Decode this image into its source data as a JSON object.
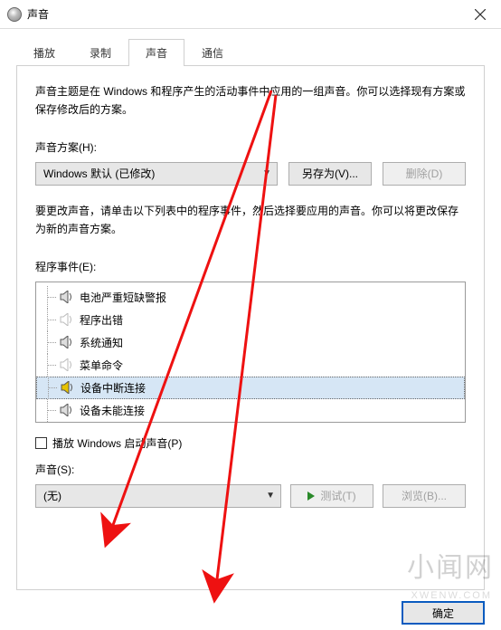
{
  "window": {
    "title": "声音"
  },
  "tabs": [
    "播放",
    "录制",
    "声音",
    "通信"
  ],
  "panel": {
    "description": "声音主题是在 Windows 和程序产生的活动事件中应用的一组声音。你可以选择现有方案或保存修改后的方案。",
    "scheme_label": "声音方案(H):",
    "scheme_value": "Windows 默认 (已修改)",
    "save_as": "另存为(V)...",
    "delete": "删除(D)",
    "events_description": "要更改声音，请单击以下列表中的程序事件，然后选择要应用的声音。你可以将更改保存为新的声音方案。",
    "events_label": "程序事件(E):",
    "events": [
      {
        "label": "电池严重短缺警报",
        "has_sound": true,
        "selected": false
      },
      {
        "label": "程序出错",
        "has_sound": false,
        "selected": false
      },
      {
        "label": "系统通知",
        "has_sound": true,
        "selected": false
      },
      {
        "label": "菜单命令",
        "has_sound": false,
        "selected": false
      },
      {
        "label": "设备中断连接",
        "has_sound": true,
        "selected": true
      },
      {
        "label": "设备未能连接",
        "has_sound": true,
        "selected": false
      }
    ],
    "play_startup_sound": "播放 Windows 启动声音(P)",
    "sound_label": "声音(S):",
    "sound_value": "(无)",
    "test": "测试(T)",
    "browse": "浏览(B)..."
  },
  "footer": {
    "ok": "确定"
  },
  "watermark": {
    "big": "小闻网",
    "small": "XWENW.COM"
  }
}
